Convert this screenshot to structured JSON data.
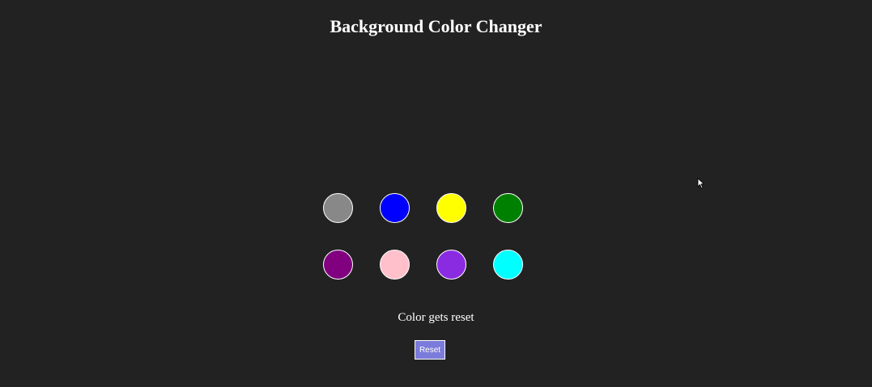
{
  "page": {
    "title": "Background Color Changer",
    "background": "#222222"
  },
  "swatches": [
    {
      "name": "gray",
      "color": "#888888"
    },
    {
      "name": "blue",
      "color": "#0000ff"
    },
    {
      "name": "yellow",
      "color": "#ffff00"
    },
    {
      "name": "green",
      "color": "#008000"
    },
    {
      "name": "purple",
      "color": "#800080"
    },
    {
      "name": "pink",
      "color": "#ffc0cb"
    },
    {
      "name": "blueviolet",
      "color": "#8a2be2"
    },
    {
      "name": "cyan",
      "color": "#00ffff"
    }
  ],
  "status": {
    "text": "Color gets reset"
  },
  "reset": {
    "label": "Reset",
    "color": "#7b7bdb"
  },
  "cursor": {
    "icon": "mouse-pointer-icon"
  }
}
